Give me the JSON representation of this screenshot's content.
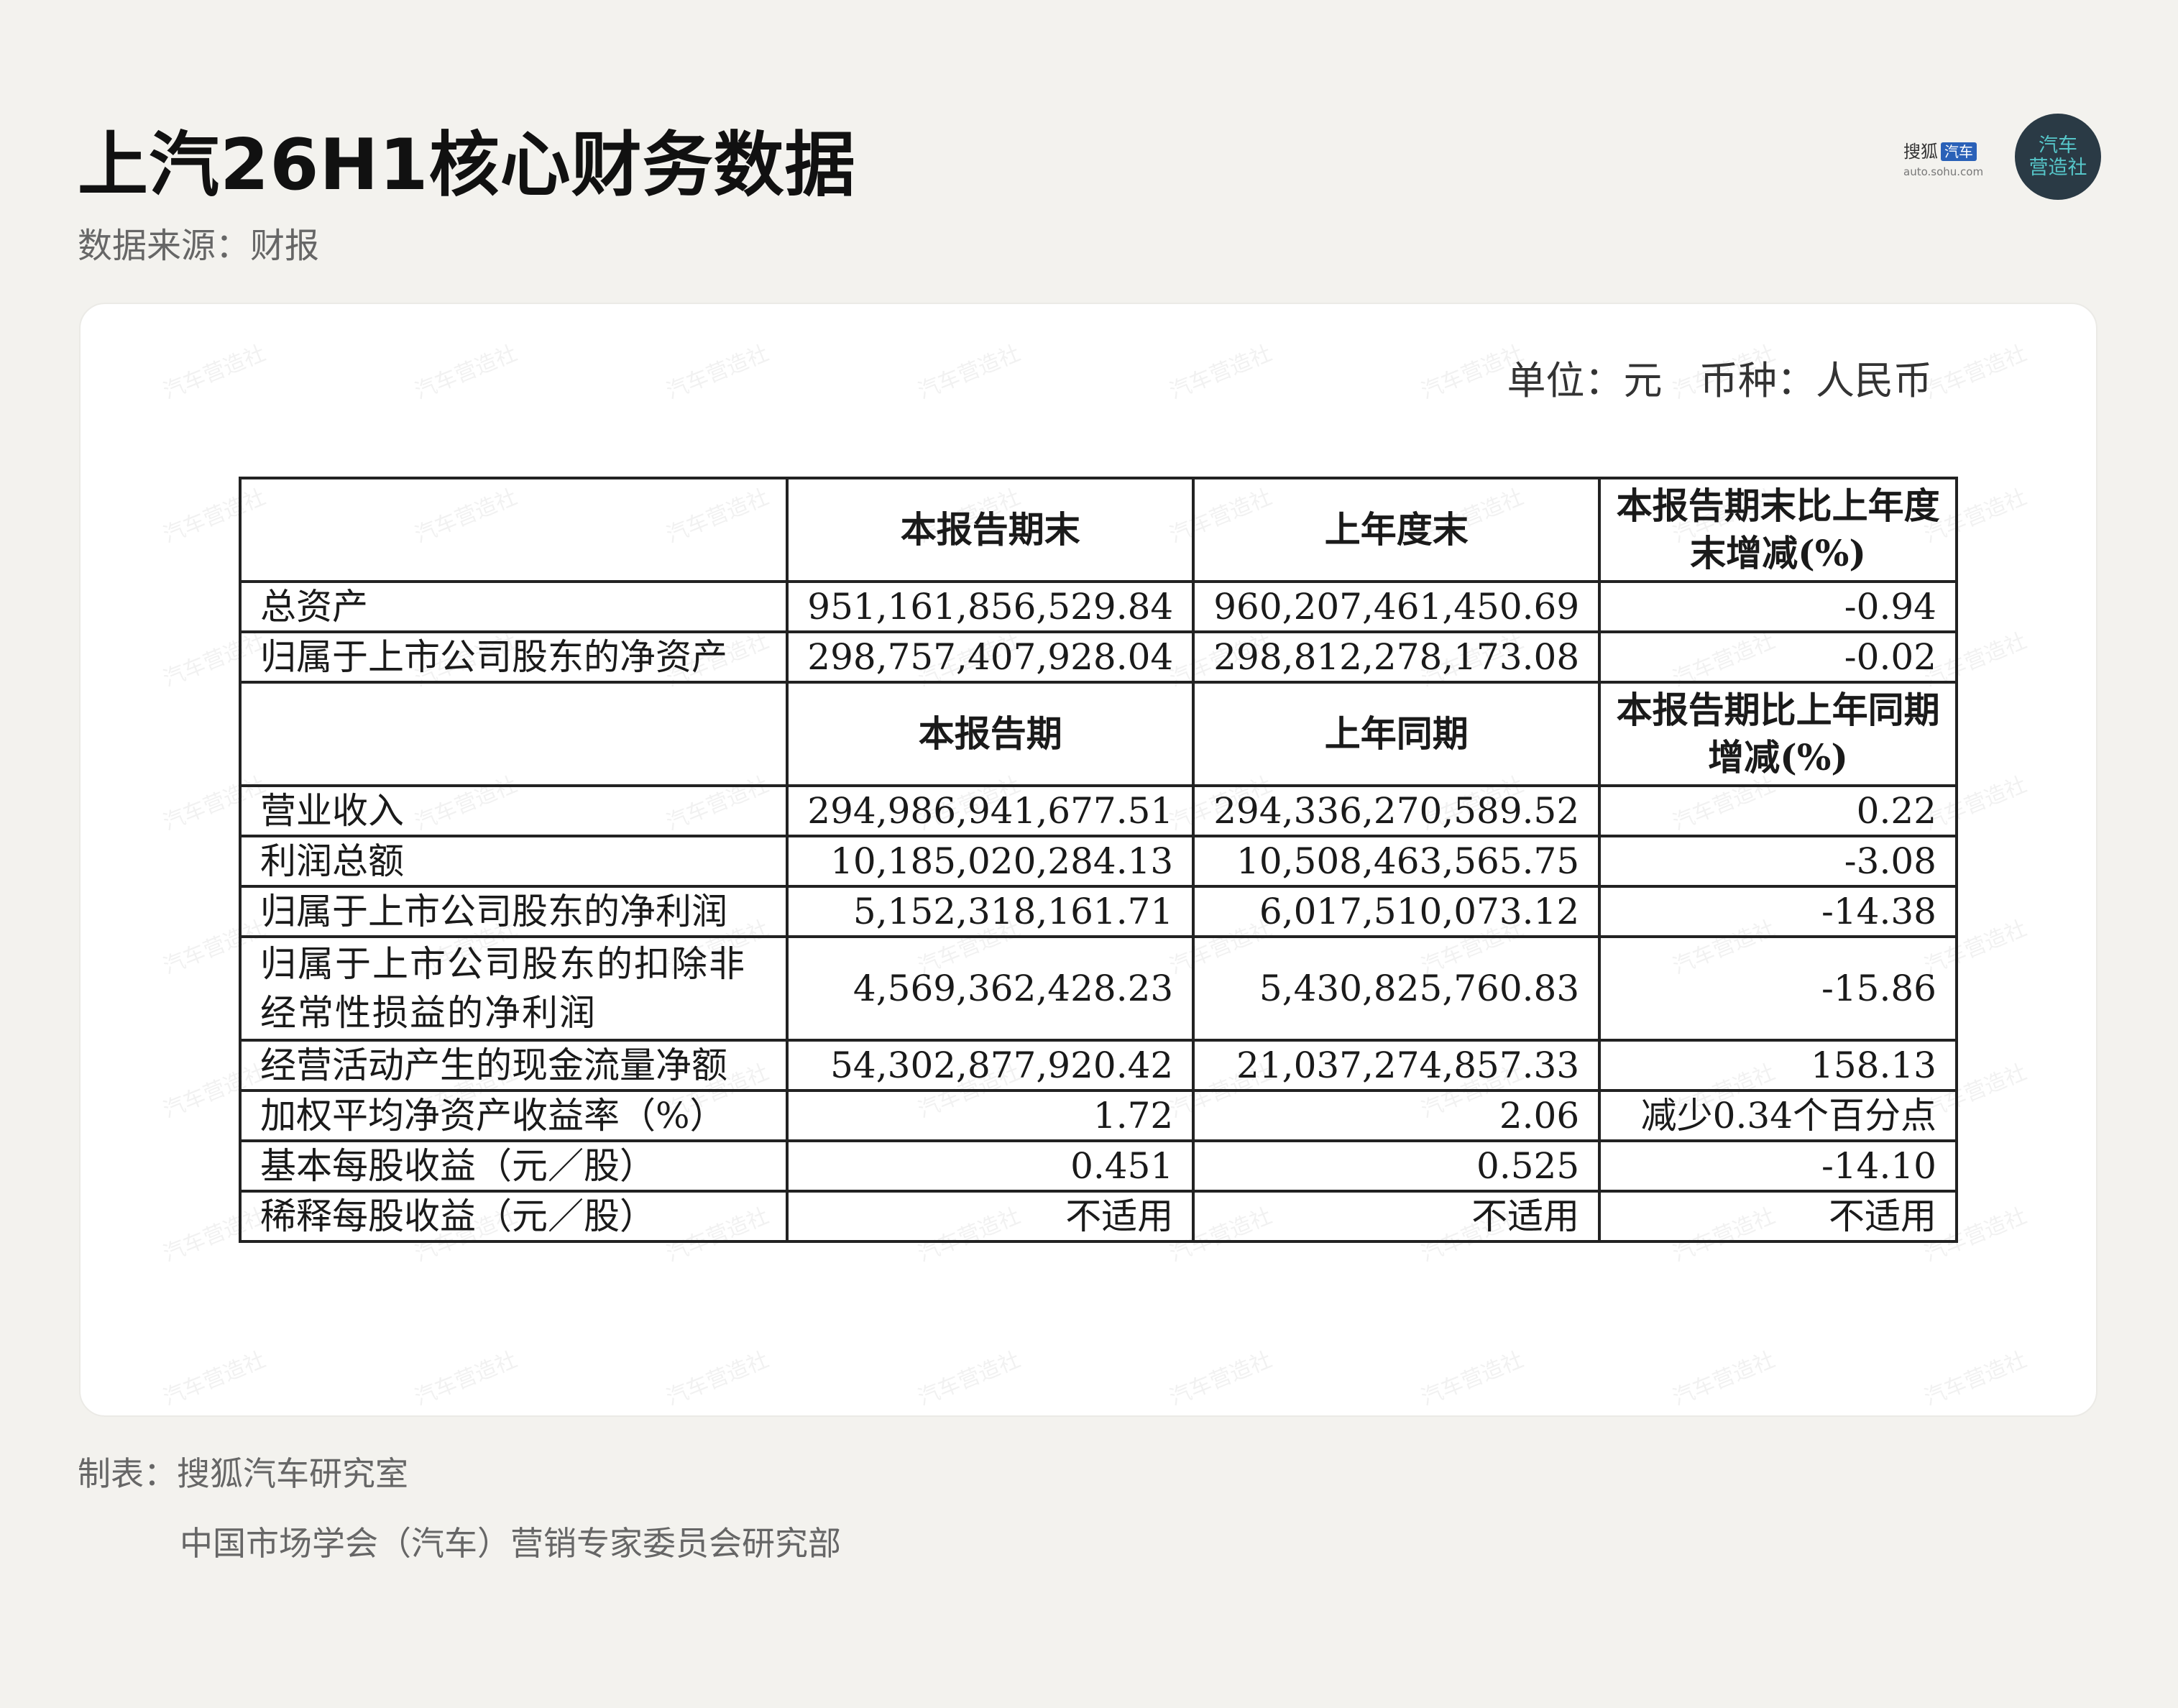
{
  "title": "上汽26H1核心财务数据",
  "source": "数据来源：财报",
  "logo": {
    "brand_cn": "搜狐",
    "brand_tag": "汽车",
    "url": "auto.sohu.com",
    "circle_line1": "汽车",
    "circle_line2": "营造社",
    "colors": {
      "brand_blue": "#2a61b8",
      "circle_bg": "#2a3a45",
      "circle_text": "#56c6c9"
    }
  },
  "watermark_text": "汽车营造社",
  "unit_line": "单位：元   币种：人民币",
  "table": {
    "header1": [
      "",
      "本报告期末",
      "上年度末",
      "本报告期末比上年度末增减(%)"
    ],
    "rows1": [
      {
        "label": "总资产",
        "current": "951,161,856,529.84",
        "previous": "960,207,461,450.69",
        "change": "-0.94"
      },
      {
        "label": "归属于上市公司股东的净资产",
        "current": "298,757,407,928.04",
        "previous": "298,812,278,173.08",
        "change": "-0.02"
      }
    ],
    "header2": [
      "",
      "本报告期",
      "上年同期",
      "本报告期比上年同期增减(%)"
    ],
    "rows2": [
      {
        "label": "营业收入",
        "current": "294,986,941,677.51",
        "previous": "294,336,270,589.52",
        "change": "0.22"
      },
      {
        "label": "利润总额",
        "current": "10,185,020,284.13",
        "previous": "10,508,463,565.75",
        "change": "-3.08"
      },
      {
        "label": "归属于上市公司股东的净利润",
        "current": "5,152,318,161.71",
        "previous": "6,017,510,073.12",
        "change": "-14.38"
      },
      {
        "label": "归属于上市公司股东的扣除非经常性损益的净利润",
        "current": "4,569,362,428.23",
        "previous": "5,430,825,760.83",
        "change": "-15.86"
      },
      {
        "label": "经营活动产生的现金流量净额",
        "current": "54,302,877,920.42",
        "previous": "21,037,274,857.33",
        "change": "158.13"
      },
      {
        "label": "加权平均净资产收益率（%）",
        "current": "1.72",
        "previous": "2.06",
        "change": "减少0.34个百分点"
      },
      {
        "label": "基本每股收益（元／股）",
        "current": "0.451",
        "previous": "0.525",
        "change": "-14.10"
      },
      {
        "label": "稀释每股收益（元／股）",
        "current": "不适用",
        "previous": "不适用",
        "change": "不适用"
      }
    ]
  },
  "credit_line1": "制表：搜狐汽车研究室",
  "credit_line2": "中国市场学会（汽车）营销专家委员会研究部"
}
